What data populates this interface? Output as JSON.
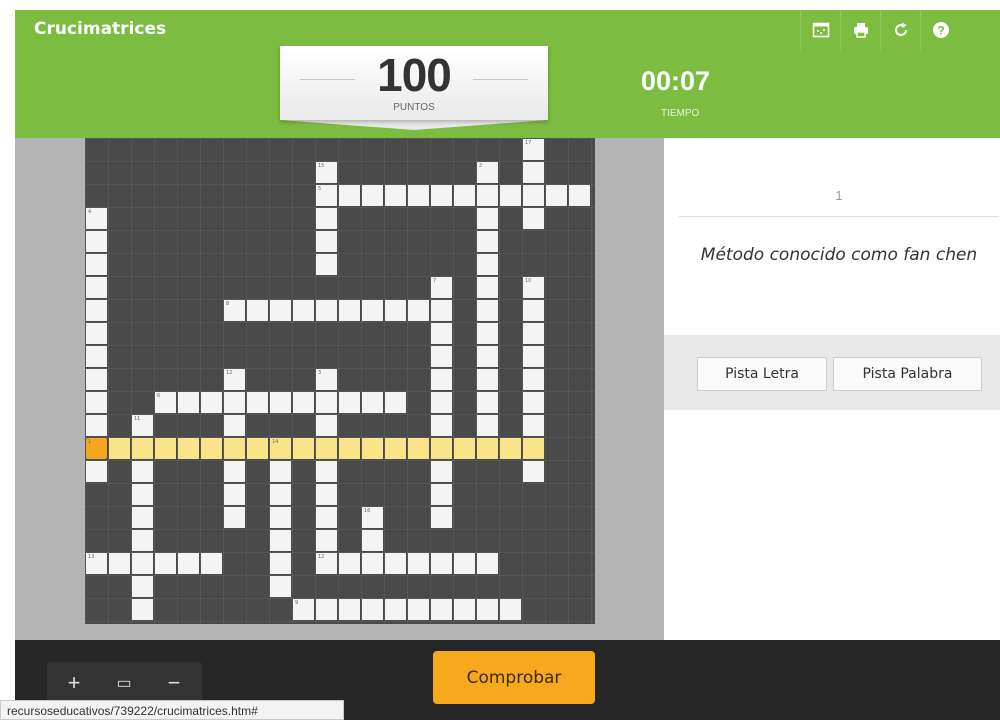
{
  "header": {
    "title": "Crucimatrices",
    "icons": [
      "puzzle-icon",
      "print-icon",
      "restart-icon",
      "help-icon"
    ]
  },
  "score": {
    "value": "100",
    "label": "PUNTOS"
  },
  "timer": {
    "value": "00:07",
    "label": "TIEMPO"
  },
  "grid": {
    "words": [
      {
        "num": "1",
        "row": 13,
        "col": 0,
        "dir": "across",
        "len": 20,
        "highlighted": true
      },
      {
        "num": "2",
        "row": 1,
        "col": 17,
        "dir": "down",
        "len": 12
      },
      {
        "num": "3",
        "row": 10,
        "col": 10,
        "dir": "down",
        "len": 9
      },
      {
        "num": "4",
        "row": 3,
        "col": 0,
        "dir": "down",
        "len": 12
      },
      {
        "num": "5",
        "row": 2,
        "col": 10,
        "dir": "across",
        "len": 12
      },
      {
        "num": "6",
        "row": 11,
        "col": 3,
        "dir": "across",
        "len": 11
      },
      {
        "num": "7",
        "row": 6,
        "col": 15,
        "dir": "down",
        "len": 11
      },
      {
        "num": "8",
        "row": 7,
        "col": 6,
        "dir": "across",
        "len": 10
      },
      {
        "num": "9",
        "row": 20,
        "col": 9,
        "dir": "across",
        "len": 10
      },
      {
        "num": "10",
        "row": 6,
        "col": 19,
        "dir": "down",
        "len": 9
      },
      {
        "num": "11",
        "row": 12,
        "col": 2,
        "dir": "down",
        "len": 9
      },
      {
        "num": "12",
        "row": 10,
        "col": 6,
        "dir": "down",
        "len": 7
      },
      {
        "num": "13",
        "row": 18,
        "col": 0,
        "dir": "across",
        "len": 6
      },
      {
        "num": "14",
        "row": 13,
        "col": 8,
        "dir": "down",
        "len": 7
      },
      {
        "num": "15",
        "row": 1,
        "col": 10,
        "dir": "down",
        "len": 5
      },
      {
        "num": "16",
        "row": 16,
        "col": 12,
        "dir": "down",
        "len": 2
      },
      {
        "num": "17",
        "row": 0,
        "col": 19,
        "dir": "down",
        "len": 4
      },
      {
        "num": "12",
        "row": 18,
        "col": 10,
        "dir": "across",
        "len": 8
      }
    ],
    "active": {
      "row": 13,
      "col": 0
    }
  },
  "clue": {
    "number": "1",
    "text": "Método conocido como fan chen"
  },
  "hints": {
    "letter": "Pista Letra",
    "word": "Pista Palabra"
  },
  "footer": {
    "zoom_in": "+",
    "zoom_fit": "▭",
    "zoom_out": "−",
    "check": "Comprobar"
  },
  "status_url": "recursoseducativos/739222/crucimatrices.htm#",
  "colors": {
    "accent": "#7cbc41",
    "highlight": "#fae48a",
    "active": "#f5a51e",
    "check_button": "#f7a81c"
  }
}
